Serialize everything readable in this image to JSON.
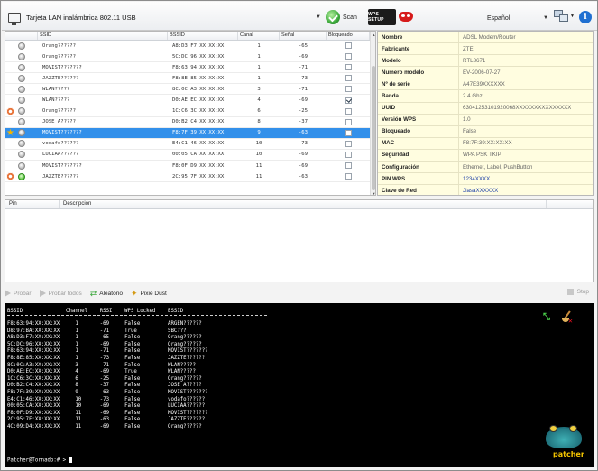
{
  "toolbar": {
    "adapter": "Tarjeta LAN inalámbrica 802.11 USB",
    "scan_label": "Scan",
    "wps_logo_text": "WPS SETUP",
    "language": "Español"
  },
  "networks": {
    "columns": [
      "SSID",
      "BSSID",
      "Canal",
      "Señal",
      "Bloqueado"
    ],
    "rows": [
      {
        "mark": "",
        "lock": "grey",
        "ssid": "Orang??????",
        "bssid": "A8:D3:F7:XX:XX:XX",
        "channel": "1",
        "signal": "-65",
        "locked": false,
        "selected": false
      },
      {
        "mark": "",
        "lock": "grey",
        "ssid": "Orang??????",
        "bssid": "5C:DC:96:XX:XX:XX",
        "channel": "1",
        "signal": "-69",
        "locked": false,
        "selected": false
      },
      {
        "mark": "",
        "lock": "grey",
        "ssid": "MOVIST???????",
        "bssid": "F8:63:94:XX:XX:XX",
        "channel": "1",
        "signal": "-71",
        "locked": false,
        "selected": false
      },
      {
        "mark": "",
        "lock": "grey",
        "ssid": "JAZZTE??????",
        "bssid": "F8:8E:85:XX:XX:XX",
        "channel": "1",
        "signal": "-73",
        "locked": false,
        "selected": false
      },
      {
        "mark": "",
        "lock": "grey",
        "ssid": "WLAN?????",
        "bssid": "8C:0C:A3:XX:XX:XX",
        "channel": "3",
        "signal": "-71",
        "locked": false,
        "selected": false
      },
      {
        "mark": "",
        "lock": "grey",
        "ssid": "WLAN?????",
        "bssid": "D0:AE:EC:XX:XX:XX",
        "channel": "4",
        "signal": "-69",
        "locked": true,
        "selected": false
      },
      {
        "mark": "target",
        "lock": "grey",
        "ssid": "Orang??????",
        "bssid": "1C:C6:3C:XX:XX:XX",
        "channel": "6",
        "signal": "-25",
        "locked": false,
        "selected": false
      },
      {
        "mark": "",
        "lock": "grey",
        "ssid": "JOSE A?????",
        "bssid": "D0:B2:C4:XX:XX:XX",
        "channel": "8",
        "signal": "-37",
        "locked": false,
        "selected": false
      },
      {
        "mark": "star",
        "lock": "grey",
        "ssid": "MOVIST???????",
        "bssid": "F8:7F:39:XX:XX:XX",
        "channel": "9",
        "signal": "-63",
        "locked": false,
        "selected": true
      },
      {
        "mark": "",
        "lock": "grey",
        "ssid": "vodafo??????",
        "bssid": "E4:C1:46:XX:XX:XX",
        "channel": "10",
        "signal": "-73",
        "locked": false,
        "selected": false
      },
      {
        "mark": "",
        "lock": "grey",
        "ssid": "LUCIAA??????",
        "bssid": "00:05:CA:XX:XX:XX",
        "channel": "10",
        "signal": "-69",
        "locked": false,
        "selected": false
      },
      {
        "mark": "",
        "lock": "grey",
        "ssid": "MOVIST???????",
        "bssid": "F8:0F:D9:XX:XX:XX",
        "channel": "11",
        "signal": "-69",
        "locked": false,
        "selected": false
      },
      {
        "mark": "target",
        "lock": "green",
        "ssid": "JAZZTE??????",
        "bssid": "2C:95:7F:XX:XX:XX",
        "channel": "11",
        "signal": "-63",
        "locked": false,
        "selected": false
      }
    ]
  },
  "details": [
    {
      "key": "Nombre",
      "value": "ADSL Modem/Router",
      "blue": false
    },
    {
      "key": "Fabricante",
      "value": "ZTE",
      "blue": false
    },
    {
      "key": "Modelo",
      "value": "RTL8671",
      "blue": false
    },
    {
      "key": "Numero modelo",
      "value": "EV-2006-07-27",
      "blue": false
    },
    {
      "key": "Nº de serie",
      "value": "A47E39XXXXXX",
      "blue": false
    },
    {
      "key": "Banda",
      "value": "2.4 Ghz",
      "blue": false
    },
    {
      "key": "UUID",
      "value": "63041253101920068XXXXXXXXXXXXXXX",
      "blue": false
    },
    {
      "key": "Versión WPS",
      "value": "1.0",
      "blue": false
    },
    {
      "key": "Bloqueado",
      "value": "False",
      "blue": false
    },
    {
      "key": "MAC",
      "value": "F8:7F:39:XX:XX:XX",
      "blue": false
    },
    {
      "key": "Seguridad",
      "value": "WPA PSK TKIP",
      "blue": false
    },
    {
      "key": "Configuración",
      "value": "Ethernet, Label, PushButton",
      "blue": false
    },
    {
      "key": "PIN WPS",
      "value": "1234XXXX",
      "blue": true
    },
    {
      "key": "Clave de Red",
      "value": "JiasaXXXXXX",
      "blue": true
    }
  ],
  "pin_table": {
    "col_pin": "Pin",
    "col_desc": "Descripción"
  },
  "actions": {
    "probar": "Probar",
    "probar_todos": "Probar todos",
    "aleatorio": "Aleatorio",
    "pixie_dust": "Pixie Dust",
    "stop": "Stop"
  },
  "console": {
    "header": "BSSID              Channel    RSSI    WPS Locked    ESSID",
    "rows": [
      "F8:63:94:XX:XX:XX     1       -69     False         ARGEN??????",
      "D8:97:BA:XX:XX:XX     1       -71     True          5BC???",
      "A8:D3:F7:XX:XX:XX     1       -65     False         Orang??????",
      "5C:DC:96:XX:XX:XX     1       -69     False         Orang??????",
      "F8:63:94:XX:XX:XX     1       -71     False         MOVIST???????",
      "F8:8E:85:XX:XX:XX     1       -73     False         JAZZTE??????",
      "8C:0C:A3:XX:XX:XX     3       -71     False         WLAN?????",
      "D0:AE:EC:XX:XX:XX     4       -69     True          WLAN?????",
      "1C:C6:3C:XX:XX:XX     6       -25     False         Orang??????",
      "D0:B2:C4:XX:XX:XX     8       -37     False         JOSE A?????",
      "F8:7F:39:XX:XX:XX     9       -63     False         MOVIST???????",
      "E4:C1:46:XX:XX:XX     10      -73     False         vodafo??????",
      "00:05:CA:XX:XX:XX     10      -69     False         LUCIAA??????",
      "F8:0F:D9:XX:XX:XX     11      -69     False         MOVIST???????",
      "2C:95:7F:XX:XX:XX     11      -63     False         JAZZTE??????",
      "4C:09:D4:XX:XX:XX     11      -69     False         Orang??????"
    ],
    "prompt": "Patcher@Tornado:# > "
  },
  "logo": {
    "name": "patcher"
  }
}
